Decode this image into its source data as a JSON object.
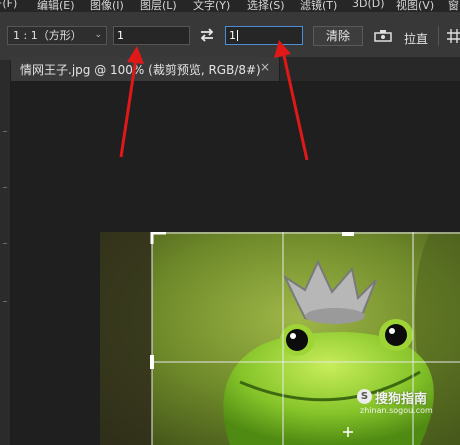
{
  "menubar": {
    "items": [
      "F(F)",
      "编辑(E)",
      "图像(I)",
      "图层(L)",
      "文字(Y)",
      "选择(S)",
      "滤镜(T)",
      "3D(D)",
      "视图(V)",
      "窗"
    ]
  },
  "options": {
    "ratio_select": "1 : 1（方形）",
    "width_value": "1",
    "height_value": "1",
    "clear_label": "清除",
    "straighten_label": "拉直"
  },
  "document_tab": {
    "title": "情网王子.jpg @ 100% (裁剪预览, RGB/8#)",
    "close": "×"
  },
  "watermark": {
    "text": "搜狗指南",
    "url": "zhinan.sogou.com",
    "icon_glyph": "S"
  },
  "colors": {
    "panel": "#383838",
    "canvas": "#1f1f1f",
    "annotation_arrow": "#e01818",
    "field_focus": "#4a8fd6"
  }
}
